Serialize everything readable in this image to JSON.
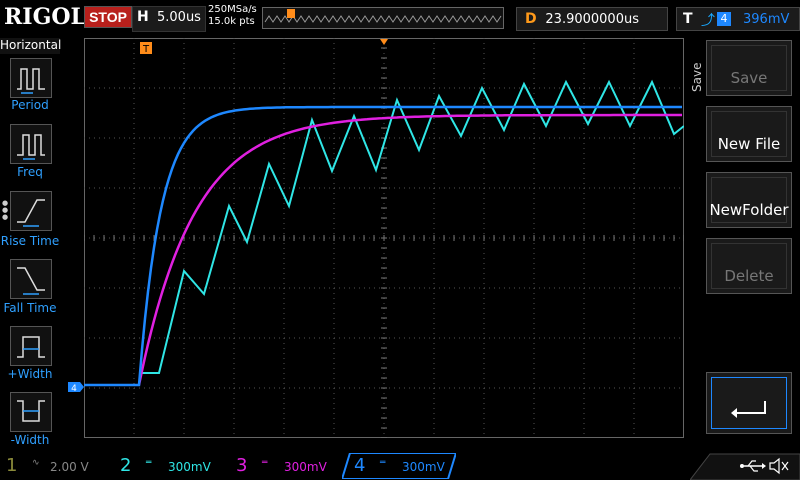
{
  "brand": "RIGOL",
  "run_state": "STOP",
  "horizontal": {
    "label": "H",
    "timebase": "5.00us",
    "sample_rate": "250MSa/s",
    "points": "15.0k pts"
  },
  "delay": {
    "label": "D",
    "value": "23.9000000us"
  },
  "trigger": {
    "label": "T",
    "edge_icon": "rising-edge-icon",
    "source": "4",
    "level": "396mV"
  },
  "left_menu": {
    "title": "Horizontal",
    "items": [
      {
        "label": "Period",
        "icon": "period-icon"
      },
      {
        "label": "Freq",
        "icon": "freq-icon"
      },
      {
        "label": "Rise Time",
        "icon": "rise-time-icon"
      },
      {
        "label": "Fall Time",
        "icon": "fall-time-icon"
      },
      {
        "label": "+Width",
        "icon": "pos-width-icon"
      },
      {
        "label": "-Width",
        "icon": "neg-width-icon"
      }
    ]
  },
  "right_menu": {
    "title": "Save",
    "buttons": [
      {
        "label": "Save",
        "enabled": false
      },
      {
        "label": "New File",
        "enabled": true
      },
      {
        "label": "NewFolder",
        "enabled": true
      },
      {
        "label": "Delete",
        "enabled": false
      },
      {
        "label": "",
        "icon": "enter-return-icon",
        "enabled": true
      }
    ]
  },
  "channels": [
    {
      "num": "1",
      "coupling": "ac-coupling-icon",
      "scale": "2.00 V",
      "color": "#c8c800",
      "active": false
    },
    {
      "num": "2",
      "coupling": "dc-coupling-icon",
      "scale": "300mV",
      "color": "#2fe6e6",
      "active": true
    },
    {
      "num": "3",
      "coupling": "dc-coupling-icon",
      "scale": "300mV",
      "color": "#e020e0",
      "active": true
    },
    {
      "num": "4",
      "coupling": "dc-coupling-icon",
      "scale": "300mV",
      "color": "#1e88ff",
      "active": true,
      "selected": true
    }
  ],
  "markers": {
    "trigger_pos": "T",
    "channel4_ground": "4",
    "trigger_level": "T"
  },
  "status_icons": [
    "usb-icon",
    "speaker-muted-icon"
  ],
  "colors": {
    "ch2": "#2fe6e6",
    "ch3": "#e020e0",
    "ch4": "#1e88ff",
    "trigger": "#ff8c1a"
  }
}
